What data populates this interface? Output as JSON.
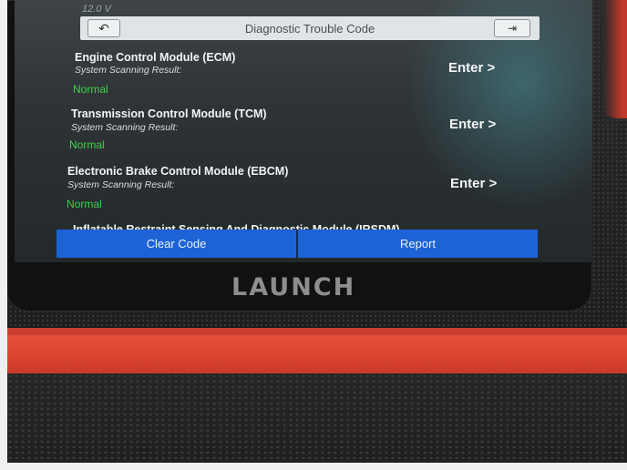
{
  "status_bar": {
    "voltage": "12.0 V"
  },
  "header": {
    "title": "Diagnostic Trouble Code",
    "back_icon": "back-arrow-icon",
    "exit_icon": "exit-icon"
  },
  "modules": [
    {
      "name": "Engine Control Module (ECM)",
      "subtitle": "System Scanning Result:",
      "status": "Normal",
      "enter_label": "Enter >"
    },
    {
      "name": "Transmission Control Module (TCM)",
      "subtitle": "System Scanning Result:",
      "status": "Normal",
      "enter_label": "Enter >"
    },
    {
      "name": "Electronic Brake Control Module (EBCM)",
      "subtitle": "System Scanning Result:",
      "status": "Normal",
      "enter_label": "Enter >"
    }
  ],
  "partial_module": {
    "name": "Inflatable Restraint Sensing And Diagnostic Module (IRSDM)"
  },
  "actions": {
    "clear_label": "Clear Code",
    "report_label": "Report"
  },
  "device": {
    "brand": "LAUNCH"
  },
  "colors": {
    "accent": "#1d63d6",
    "status_ok": "#3fd24a",
    "bumper": "#d9422f"
  }
}
